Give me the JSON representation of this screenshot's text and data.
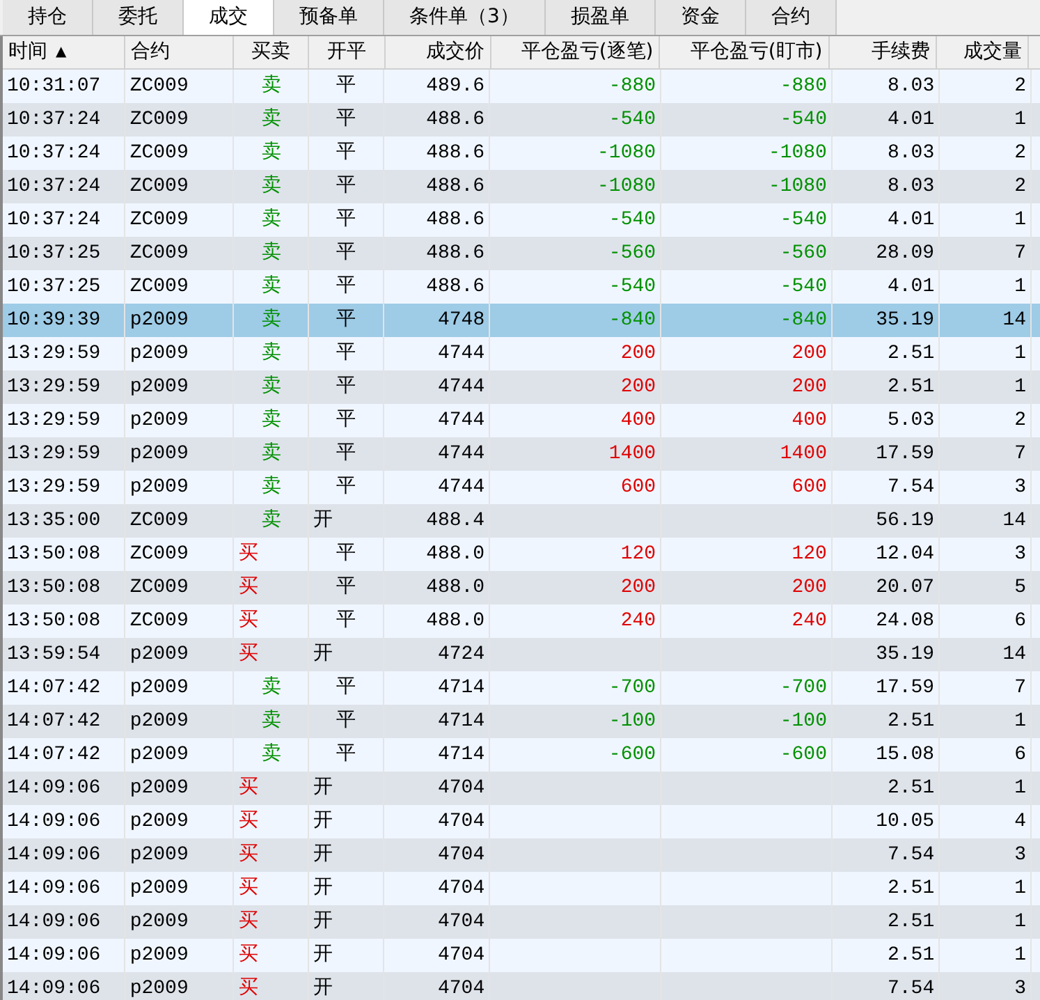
{
  "tabs": [
    {
      "label": "持仓",
      "selected": false
    },
    {
      "label": "委托",
      "selected": false
    },
    {
      "label": "成交",
      "selected": true
    },
    {
      "label": "预备单",
      "selected": false
    },
    {
      "label": "条件单（3）",
      "selected": false
    },
    {
      "label": "损盈单",
      "selected": false
    },
    {
      "label": "资金",
      "selected": false
    },
    {
      "label": "合约",
      "selected": false
    }
  ],
  "table": {
    "columns": [
      {
        "label": "时间",
        "sort_icon": "▲"
      },
      {
        "label": "合约"
      },
      {
        "label": "买卖"
      },
      {
        "label": "开平"
      },
      {
        "label": "成交价"
      },
      {
        "label": "平仓盈亏(逐笔)"
      },
      {
        "label": "平仓盈亏(盯市)"
      },
      {
        "label": "手续费"
      },
      {
        "label": "成交量"
      }
    ],
    "rows": [
      {
        "time": "10:31:07",
        "contract": "ZC009",
        "side": {
          "text": "卖",
          "kind": "sell"
        },
        "offset": {
          "text": "平",
          "kind": "close"
        },
        "price": "489.6",
        "pnl": {
          "kind": "loss",
          "trade": "-880",
          "mark": "-880"
        },
        "fee": "8.03",
        "volume": "2",
        "selected": false
      },
      {
        "time": "10:37:24",
        "contract": "ZC009",
        "side": {
          "text": "卖",
          "kind": "sell"
        },
        "offset": {
          "text": "平",
          "kind": "close"
        },
        "price": "488.6",
        "pnl": {
          "kind": "loss",
          "trade": "-540",
          "mark": "-540"
        },
        "fee": "4.01",
        "volume": "1",
        "selected": false
      },
      {
        "time": "10:37:24",
        "contract": "ZC009",
        "side": {
          "text": "卖",
          "kind": "sell"
        },
        "offset": {
          "text": "平",
          "kind": "close"
        },
        "price": "488.6",
        "pnl": {
          "kind": "loss",
          "trade": "-1080",
          "mark": "-1080"
        },
        "fee": "8.03",
        "volume": "2",
        "selected": false
      },
      {
        "time": "10:37:24",
        "contract": "ZC009",
        "side": {
          "text": "卖",
          "kind": "sell"
        },
        "offset": {
          "text": "平",
          "kind": "close"
        },
        "price": "488.6",
        "pnl": {
          "kind": "loss",
          "trade": "-1080",
          "mark": "-1080"
        },
        "fee": "8.03",
        "volume": "2",
        "selected": false
      },
      {
        "time": "10:37:24",
        "contract": "ZC009",
        "side": {
          "text": "卖",
          "kind": "sell"
        },
        "offset": {
          "text": "平",
          "kind": "close"
        },
        "price": "488.6",
        "pnl": {
          "kind": "loss",
          "trade": "-540",
          "mark": "-540"
        },
        "fee": "4.01",
        "volume": "1",
        "selected": false
      },
      {
        "time": "10:37:25",
        "contract": "ZC009",
        "side": {
          "text": "卖",
          "kind": "sell"
        },
        "offset": {
          "text": "平",
          "kind": "close"
        },
        "price": "488.6",
        "pnl": {
          "kind": "loss",
          "trade": "-560",
          "mark": "-560"
        },
        "fee": "28.09",
        "volume": "7",
        "selected": false
      },
      {
        "time": "10:37:25",
        "contract": "ZC009",
        "side": {
          "text": "卖",
          "kind": "sell"
        },
        "offset": {
          "text": "平",
          "kind": "close"
        },
        "price": "488.6",
        "pnl": {
          "kind": "loss",
          "trade": "-540",
          "mark": "-540"
        },
        "fee": "4.01",
        "volume": "1",
        "selected": false
      },
      {
        "time": "10:39:39",
        "contract": "p2009",
        "side": {
          "text": "卖",
          "kind": "sell"
        },
        "offset": {
          "text": "平",
          "kind": "close"
        },
        "price": "4748",
        "pnl": {
          "kind": "loss",
          "trade": "-840",
          "mark": "-840"
        },
        "fee": "35.19",
        "volume": "14",
        "selected": true
      },
      {
        "time": "13:29:59",
        "contract": "p2009",
        "side": {
          "text": "卖",
          "kind": "sell"
        },
        "offset": {
          "text": "平",
          "kind": "close"
        },
        "price": "4744",
        "pnl": {
          "kind": "profit",
          "trade": "200",
          "mark": "200"
        },
        "fee": "2.51",
        "volume": "1",
        "selected": false
      },
      {
        "time": "13:29:59",
        "contract": "p2009",
        "side": {
          "text": "卖",
          "kind": "sell"
        },
        "offset": {
          "text": "平",
          "kind": "close"
        },
        "price": "4744",
        "pnl": {
          "kind": "profit",
          "trade": "200",
          "mark": "200"
        },
        "fee": "2.51",
        "volume": "1",
        "selected": false
      },
      {
        "time": "13:29:59",
        "contract": "p2009",
        "side": {
          "text": "卖",
          "kind": "sell"
        },
        "offset": {
          "text": "平",
          "kind": "close"
        },
        "price": "4744",
        "pnl": {
          "kind": "profit",
          "trade": "400",
          "mark": "400"
        },
        "fee": "5.03",
        "volume": "2",
        "selected": false
      },
      {
        "time": "13:29:59",
        "contract": "p2009",
        "side": {
          "text": "卖",
          "kind": "sell"
        },
        "offset": {
          "text": "平",
          "kind": "close"
        },
        "price": "4744",
        "pnl": {
          "kind": "profit",
          "trade": "1400",
          "mark": "1400"
        },
        "fee": "17.59",
        "volume": "7",
        "selected": false
      },
      {
        "time": "13:29:59",
        "contract": "p2009",
        "side": {
          "text": "卖",
          "kind": "sell"
        },
        "offset": {
          "text": "平",
          "kind": "close"
        },
        "price": "4744",
        "pnl": {
          "kind": "profit",
          "trade": "600",
          "mark": "600"
        },
        "fee": "7.54",
        "volume": "3",
        "selected": false
      },
      {
        "time": "13:35:00",
        "contract": "ZC009",
        "side": {
          "text": "卖",
          "kind": "sell"
        },
        "offset": {
          "text": "开",
          "kind": "open"
        },
        "price": "488.4",
        "fee": "56.19",
        "volume": "14",
        "selected": false
      },
      {
        "time": "13:50:08",
        "contract": "ZC009",
        "side": {
          "text": "买",
          "kind": "buy"
        },
        "offset": {
          "text": "平",
          "kind": "close"
        },
        "price": "488.0",
        "pnl": {
          "kind": "profit",
          "trade": "120",
          "mark": "120"
        },
        "fee": "12.04",
        "volume": "3",
        "selected": false
      },
      {
        "time": "13:50:08",
        "contract": "ZC009",
        "side": {
          "text": "买",
          "kind": "buy"
        },
        "offset": {
          "text": "平",
          "kind": "close"
        },
        "price": "488.0",
        "pnl": {
          "kind": "profit",
          "trade": "200",
          "mark": "200"
        },
        "fee": "20.07",
        "volume": "5",
        "selected": false
      },
      {
        "time": "13:50:08",
        "contract": "ZC009",
        "side": {
          "text": "买",
          "kind": "buy"
        },
        "offset": {
          "text": "平",
          "kind": "close"
        },
        "price": "488.0",
        "pnl": {
          "kind": "profit",
          "trade": "240",
          "mark": "240"
        },
        "fee": "24.08",
        "volume": "6",
        "selected": false
      },
      {
        "time": "13:59:54",
        "contract": "p2009",
        "side": {
          "text": "买",
          "kind": "buy"
        },
        "offset": {
          "text": "开",
          "kind": "open"
        },
        "price": "4724",
        "fee": "35.19",
        "volume": "14",
        "selected": false
      },
      {
        "time": "14:07:42",
        "contract": "p2009",
        "side": {
          "text": "卖",
          "kind": "sell"
        },
        "offset": {
          "text": "平",
          "kind": "close"
        },
        "price": "4714",
        "pnl": {
          "kind": "loss",
          "trade": "-700",
          "mark": "-700"
        },
        "fee": "17.59",
        "volume": "7",
        "selected": false
      },
      {
        "time": "14:07:42",
        "contract": "p2009",
        "side": {
          "text": "卖",
          "kind": "sell"
        },
        "offset": {
          "text": "平",
          "kind": "close"
        },
        "price": "4714",
        "pnl": {
          "kind": "loss",
          "trade": "-100",
          "mark": "-100"
        },
        "fee": "2.51",
        "volume": "1",
        "selected": false
      },
      {
        "time": "14:07:42",
        "contract": "p2009",
        "side": {
          "text": "卖",
          "kind": "sell"
        },
        "offset": {
          "text": "平",
          "kind": "close"
        },
        "price": "4714",
        "pnl": {
          "kind": "loss",
          "trade": "-600",
          "mark": "-600"
        },
        "fee": "15.08",
        "volume": "6",
        "selected": false
      },
      {
        "time": "14:09:06",
        "contract": "p2009",
        "side": {
          "text": "买",
          "kind": "buy"
        },
        "offset": {
          "text": "开",
          "kind": "open"
        },
        "price": "4704",
        "fee": "2.51",
        "volume": "1",
        "selected": false
      },
      {
        "time": "14:09:06",
        "contract": "p2009",
        "side": {
          "text": "买",
          "kind": "buy"
        },
        "offset": {
          "text": "开",
          "kind": "open"
        },
        "price": "4704",
        "fee": "10.05",
        "volume": "4",
        "selected": false
      },
      {
        "time": "14:09:06",
        "contract": "p2009",
        "side": {
          "text": "买",
          "kind": "buy"
        },
        "offset": {
          "text": "开",
          "kind": "open"
        },
        "price": "4704",
        "fee": "7.54",
        "volume": "3",
        "selected": false
      },
      {
        "time": "14:09:06",
        "contract": "p2009",
        "side": {
          "text": "买",
          "kind": "buy"
        },
        "offset": {
          "text": "开",
          "kind": "open"
        },
        "price": "4704",
        "fee": "2.51",
        "volume": "1",
        "selected": false
      },
      {
        "time": "14:09:06",
        "contract": "p2009",
        "side": {
          "text": "买",
          "kind": "buy"
        },
        "offset": {
          "text": "开",
          "kind": "open"
        },
        "price": "4704",
        "fee": "2.51",
        "volume": "1",
        "selected": false
      },
      {
        "time": "14:09:06",
        "contract": "p2009",
        "side": {
          "text": "买",
          "kind": "buy"
        },
        "offset": {
          "text": "开",
          "kind": "open"
        },
        "price": "4704",
        "fee": "2.51",
        "volume": "1",
        "selected": false
      },
      {
        "time": "14:09:06",
        "contract": "p2009",
        "side": {
          "text": "买",
          "kind": "buy"
        },
        "offset": {
          "text": "开",
          "kind": "open"
        },
        "price": "4704",
        "fee": "7.54",
        "volume": "3",
        "selected": false
      }
    ]
  }
}
